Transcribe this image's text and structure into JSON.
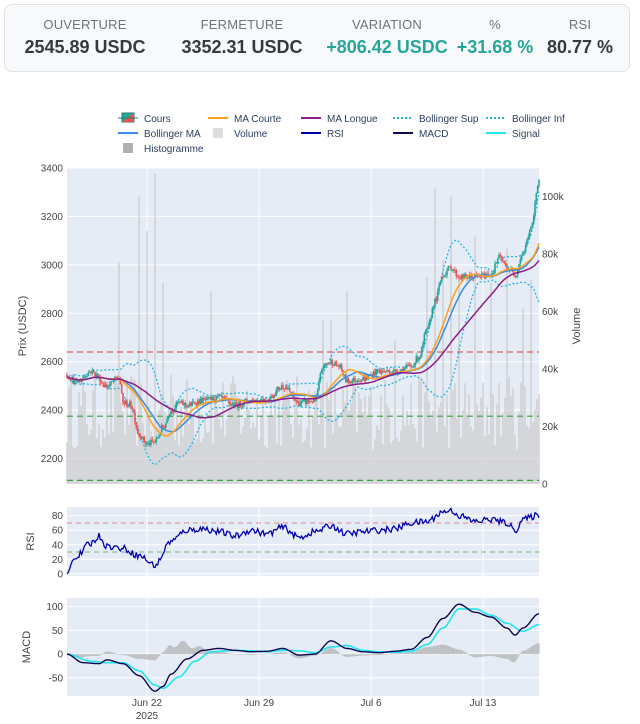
{
  "stats": [
    {
      "label": "OUVERTURE",
      "value": "2545.89 USDC",
      "positive": false
    },
    {
      "label": "FERMETURE",
      "value": "3352.31 USDC",
      "positive": false
    },
    {
      "label": "VARIATION",
      "value": "+806.42 USDC",
      "positive": true
    },
    {
      "label": "%",
      "value": "+31.68 %",
      "positive": true
    },
    {
      "label": "RSI",
      "value": "80.77 %",
      "positive": false
    }
  ],
  "colors": {
    "increasing": "#26a69a",
    "decreasing": "#ef5350",
    "ma_short": "#ff9f1c",
    "ma_long": "#8b1e8b",
    "bollinger": "#2bb3e8",
    "bollinger_ma": "#3c8de0",
    "volume": "#c8c8c8",
    "rsi": "#0000b0",
    "macd": "#0a0a50",
    "signal": "#22e5f0",
    "histogram": "#b0b0b0",
    "plot_bg": "#e5ecf6",
    "resistance": "#e06060",
    "support": "#3da13d"
  },
  "chart_data": [
    {
      "type": "candlestick",
      "legend": [
        "Cours",
        "MA Courte",
        "MA Longue",
        "Bollinger Sup",
        "Bollinger Inf",
        "Bollinger MA",
        "Volume",
        "RSI",
        "MACD",
        "Signal",
        "Histogramme"
      ],
      "ylabel": "Prix (USDC)",
      "y2label": "Volume",
      "ylim": [
        2095,
        3400
      ],
      "y2lim": [
        0,
        110000
      ],
      "y_ticks": [
        2200,
        2400,
        2600,
        2800,
        3000,
        3200,
        3400
      ],
      "y2_ticks": [
        "0",
        "20k",
        "40k",
        "60k",
        "80k",
        "100k"
      ],
      "y2_tick_values": [
        0,
        20000,
        40000,
        60000,
        80000,
        100000
      ],
      "x_ticks": [
        {
          "date": "2025-06-22",
          "label": "Jun 22",
          "sub": "2025"
        },
        {
          "date": "2025-06-29",
          "label": "Jun 29",
          "sub": ""
        },
        {
          "date": "2025-07-06",
          "label": "Jul 6",
          "sub": ""
        },
        {
          "date": "2025-07-13",
          "label": "Jul 13",
          "sub": ""
        }
      ],
      "xlim": [
        "2025-06-17T00:00",
        "2025-07-16T12:00"
      ],
      "resistance_levels": [
        2640
      ],
      "support_levels": [
        2375,
        2110
      ],
      "open_first": 2545.89,
      "close_last": 3352.31,
      "anchors": [
        [
          "2025-06-17T00:00",
          2545
        ],
        [
          "2025-06-17T14:00",
          2515
        ],
        [
          "2025-06-18T12:00",
          2560
        ],
        [
          "2025-06-19T12:00",
          2500
        ],
        [
          "2025-06-20T06:00",
          2535
        ],
        [
          "2025-06-20T12:00",
          2430
        ],
        [
          "2025-06-21T00:00",
          2420
        ],
        [
          "2025-06-21T12:00",
          2300
        ],
        [
          "2025-06-22T00:00",
          2260
        ],
        [
          "2025-06-22T12:00",
          2270
        ],
        [
          "2025-06-23T00:00",
          2330
        ],
        [
          "2025-06-23T12:00",
          2400
        ],
        [
          "2025-06-24T00:00",
          2430
        ],
        [
          "2025-06-24T12:00",
          2420
        ],
        [
          "2025-06-25T12:00",
          2440
        ],
        [
          "2025-06-26T12:00",
          2450
        ],
        [
          "2025-06-27T12:00",
          2420
        ],
        [
          "2025-06-28T12:00",
          2440
        ],
        [
          "2025-06-29T12:00",
          2445
        ],
        [
          "2025-06-30T12:00",
          2500
        ],
        [
          "2025-07-01T12:00",
          2430
        ],
        [
          "2025-07-02T12:00",
          2440
        ],
        [
          "2025-07-03T00:00",
          2580
        ],
        [
          "2025-07-03T12:00",
          2600
        ],
        [
          "2025-07-04T00:00",
          2580
        ],
        [
          "2025-07-04T12:00",
          2520
        ],
        [
          "2025-07-05T12:00",
          2530
        ],
        [
          "2025-07-06T12:00",
          2560
        ],
        [
          "2025-07-07T12:00",
          2560
        ],
        [
          "2025-07-08T12:00",
          2580
        ],
        [
          "2025-07-09T00:00",
          2620
        ],
        [
          "2025-07-09T12:00",
          2730
        ],
        [
          "2025-07-10T00:00",
          2850
        ],
        [
          "2025-07-10T12:00",
          2960
        ],
        [
          "2025-07-11T00:00",
          2990
        ],
        [
          "2025-07-11T12:00",
          2950
        ],
        [
          "2025-07-12T12:00",
          2950
        ],
        [
          "2025-07-13T12:00",
          2960
        ],
        [
          "2025-07-14T00:00",
          3030
        ],
        [
          "2025-07-14T12:00",
          2990
        ],
        [
          "2025-07-15T00:00",
          2960
        ],
        [
          "2025-07-15T12:00",
          3050
        ],
        [
          "2025-07-16T00:00",
          3150
        ],
        [
          "2025-07-16T12:00",
          3352
        ]
      ],
      "volume_spikes": [
        [
          "2025-06-20T06:00",
          77000
        ],
        [
          "2025-06-21T12:00",
          100000
        ],
        [
          "2025-06-22T00:00",
          88000
        ],
        [
          "2025-06-22T12:00",
          108000
        ],
        [
          "2025-06-23T00:00",
          70000
        ],
        [
          "2025-06-23T12:00",
          38000
        ],
        [
          "2025-06-26T00:00",
          67000
        ],
        [
          "2025-06-27T12:00",
          35000
        ],
        [
          "2025-06-30T12:00",
          33000
        ],
        [
          "2025-07-03T00:00",
          57000
        ],
        [
          "2025-07-03T12:00",
          57000
        ],
        [
          "2025-07-04T12:00",
          67000
        ],
        [
          "2025-07-07T12:00",
          50000
        ],
        [
          "2025-07-09T12:00",
          72000
        ],
        [
          "2025-07-10T00:00",
          103000
        ],
        [
          "2025-07-10T12:00",
          78000
        ],
        [
          "2025-07-11T00:00",
          100000
        ],
        [
          "2025-07-11T12:00",
          73000
        ],
        [
          "2025-07-12T12:00",
          86000
        ],
        [
          "2025-07-13T12:00",
          70000
        ],
        [
          "2025-07-14T12:00",
          82000
        ],
        [
          "2025-07-15T12:00",
          61000
        ],
        [
          "2025-07-16T00:00",
          71000
        ]
      ]
    },
    {
      "type": "line",
      "ylabel": "RSI",
      "ylim": [
        -3,
        92
      ],
      "y_ticks": [
        0,
        20,
        40,
        60,
        80
      ],
      "overbought": 70,
      "oversold": 30,
      "series": [
        {
          "name": "RSI",
          "points": [
            [
              "2025-06-17T00:00",
              0
            ],
            [
              "2025-06-17T10:00",
              20
            ],
            [
              "2025-06-18T12:00",
              42
            ],
            [
              "2025-06-19T00:00",
              52
            ],
            [
              "2025-06-19T12:00",
              38
            ],
            [
              "2025-06-20T12:00",
              35
            ],
            [
              "2025-06-21T12:00",
              25
            ],
            [
              "2025-06-22T12:00",
              12
            ],
            [
              "2025-06-23T12:00",
              45
            ],
            [
              "2025-06-24T12:00",
              60
            ],
            [
              "2025-06-25T12:00",
              62
            ],
            [
              "2025-06-26T12:00",
              58
            ],
            [
              "2025-06-27T12:00",
              52
            ],
            [
              "2025-06-28T12:00",
              60
            ],
            [
              "2025-06-29T12:00",
              55
            ],
            [
              "2025-06-30T12:00",
              64
            ],
            [
              "2025-07-01T12:00",
              50
            ],
            [
              "2025-07-02T12:00",
              58
            ],
            [
              "2025-07-03T12:00",
              66
            ],
            [
              "2025-07-04T12:00",
              55
            ],
            [
              "2025-07-05T12:00",
              58
            ],
            [
              "2025-07-06T12:00",
              60
            ],
            [
              "2025-07-07T12:00",
              62
            ],
            [
              "2025-07-08T12:00",
              70
            ],
            [
              "2025-07-09T12:00",
              72
            ],
            [
              "2025-07-10T12:00",
              85
            ],
            [
              "2025-07-11T00:00",
              88
            ],
            [
              "2025-07-11T12:00",
              80
            ],
            [
              "2025-07-12T12:00",
              72
            ],
            [
              "2025-07-13T12:00",
              75
            ],
            [
              "2025-07-14T12:00",
              70
            ],
            [
              "2025-07-15T00:00",
              60
            ],
            [
              "2025-07-15T12:00",
              75
            ],
            [
              "2025-07-16T12:00",
              81
            ]
          ]
        }
      ]
    },
    {
      "type": "line",
      "ylabel": "MACD",
      "ylim": [
        -88,
        118
      ],
      "y_ticks": [
        -50,
        0,
        50,
        100
      ],
      "series": [
        {
          "name": "MACD",
          "points": [
            [
              "2025-06-17T00:00",
              0
            ],
            [
              "2025-06-18T00:00",
              -18
            ],
            [
              "2025-06-19T00:00",
              -20
            ],
            [
              "2025-06-19T12:00",
              -12
            ],
            [
              "2025-06-20T12:00",
              -20
            ],
            [
              "2025-06-21T12:00",
              -45
            ],
            [
              "2025-06-22T12:00",
              -78
            ],
            [
              "2025-06-23T00:00",
              -68
            ],
            [
              "2025-06-23T12:00",
              -42
            ],
            [
              "2025-06-24T12:00",
              -10
            ],
            [
              "2025-06-25T12:00",
              8
            ],
            [
              "2025-06-26T12:00",
              12
            ],
            [
              "2025-06-27T12:00",
              8
            ],
            [
              "2025-06-28T12:00",
              5
            ],
            [
              "2025-06-29T12:00",
              6
            ],
            [
              "2025-06-30T12:00",
              12
            ],
            [
              "2025-07-01T12:00",
              -2
            ],
            [
              "2025-07-02T12:00",
              0
            ],
            [
              "2025-07-03T12:00",
              28
            ],
            [
              "2025-07-04T12:00",
              12
            ],
            [
              "2025-07-05T12:00",
              5
            ],
            [
              "2025-07-06T12:00",
              3
            ],
            [
              "2025-07-07T12:00",
              6
            ],
            [
              "2025-07-08T12:00",
              10
            ],
            [
              "2025-07-09T12:00",
              35
            ],
            [
              "2025-07-10T12:00",
              75
            ],
            [
              "2025-07-11T12:00",
              105
            ],
            [
              "2025-07-12T12:00",
              88
            ],
            [
              "2025-07-13T12:00",
              78
            ],
            [
              "2025-07-14T12:00",
              55
            ],
            [
              "2025-07-15T00:00",
              40
            ],
            [
              "2025-07-15T12:00",
              55
            ],
            [
              "2025-07-16T12:00",
              85
            ]
          ]
        },
        {
          "name": "Signal",
          "points": [
            [
              "2025-06-17T00:00",
              0
            ],
            [
              "2025-06-18T12:00",
              -15
            ],
            [
              "2025-06-19T12:00",
              -18
            ],
            [
              "2025-06-20T12:00",
              -18
            ],
            [
              "2025-06-21T12:00",
              -35
            ],
            [
              "2025-06-22T12:00",
              -65
            ],
            [
              "2025-06-23T00:00",
              -72
            ],
            [
              "2025-06-24T00:00",
              -48
            ],
            [
              "2025-06-25T00:00",
              -15
            ],
            [
              "2025-06-26T00:00",
              5
            ],
            [
              "2025-06-27T12:00",
              8
            ],
            [
              "2025-06-28T12:00",
              7
            ],
            [
              "2025-06-29T12:00",
              5
            ],
            [
              "2025-06-30T12:00",
              8
            ],
            [
              "2025-07-01T12:00",
              7
            ],
            [
              "2025-07-02T12:00",
              3
            ],
            [
              "2025-07-03T12:00",
              15
            ],
            [
              "2025-07-04T12:00",
              18
            ],
            [
              "2025-07-05T12:00",
              8
            ],
            [
              "2025-07-06T12:00",
              5
            ],
            [
              "2025-07-07T12:00",
              4
            ],
            [
              "2025-07-08T12:00",
              6
            ],
            [
              "2025-07-09T12:00",
              20
            ],
            [
              "2025-07-10T12:00",
              55
            ],
            [
              "2025-07-11T12:00",
              95
            ],
            [
              "2025-07-12T12:00",
              95
            ],
            [
              "2025-07-13T12:00",
              82
            ],
            [
              "2025-07-14T12:00",
              65
            ],
            [
              "2025-07-15T12:00",
              48
            ],
            [
              "2025-07-16T12:00",
              62
            ]
          ]
        }
      ]
    }
  ]
}
